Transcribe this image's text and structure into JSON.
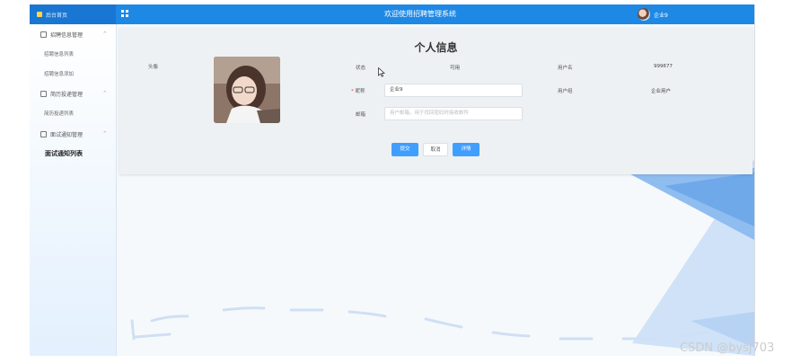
{
  "header": {
    "brand": "后台首页",
    "welcome": "欢迎使用招聘管理系统",
    "user": "企业9"
  },
  "sidebar": {
    "groups": [
      {
        "label": "招聘信息管理",
        "items": [
          "招聘信息列表",
          "招聘信息添加"
        ]
      },
      {
        "label": "简历投递管理",
        "items": [
          "简历投递列表"
        ]
      },
      {
        "label": "面试通知管理",
        "items": [
          "面试通知列表"
        ]
      }
    ]
  },
  "profile": {
    "title": "个人信息",
    "avatar_label": "头像",
    "status_label": "状态",
    "status_value": "可用",
    "username_label": "用户名",
    "username_value": "999677",
    "nickname_label": "昵称",
    "nickname_required": "*",
    "nickname_value": "企业9",
    "usergroup_label": "用户组",
    "usergroup_value": "企业用户",
    "email_label": "邮箱",
    "email_placeholder": "用户邮箱，用于找回密码时接收邮件",
    "buttons": {
      "submit": "提交",
      "cancel": "取消",
      "details": "详情"
    }
  },
  "watermark": "CSDN @bysj703",
  "colors": {
    "header": "#1e88e5",
    "primary_button": "#409eff"
  }
}
